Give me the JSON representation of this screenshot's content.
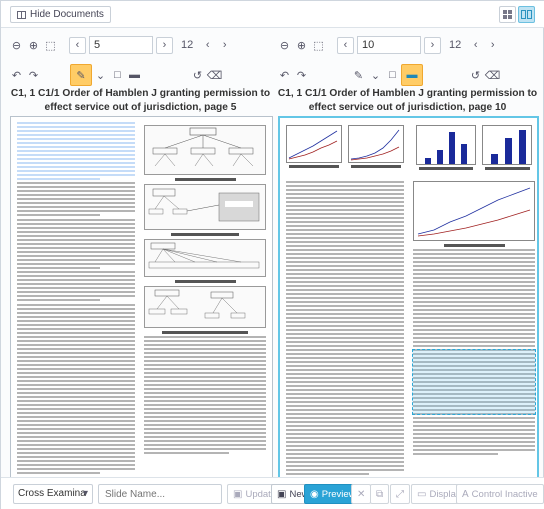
{
  "topbar": {
    "hide_documents": "Hide Documents"
  },
  "left_panel": {
    "page_value": "5",
    "page_total": "12",
    "title": "C1, 1 C1/1 Order of Hamblen J granting permission to effect service out of jurisdiction, page 5"
  },
  "right_panel": {
    "page_value": "10",
    "page_total": "12",
    "title": "C1, 1 C1/1 Order of Hamblen J granting permission to effect service out of jurisdiction, page 10"
  },
  "bottombar": {
    "select_value": "Cross Examina",
    "slide_placeholder": "Slide Name...",
    "update": "Update",
    "new": "New",
    "preview": "Preview",
    "display": "Display",
    "control": "Control Inactive"
  },
  "colors": {
    "accent": "#2aa3d6",
    "highlight_tool": "#ffcc66",
    "selected_border": "#63c6e6"
  }
}
